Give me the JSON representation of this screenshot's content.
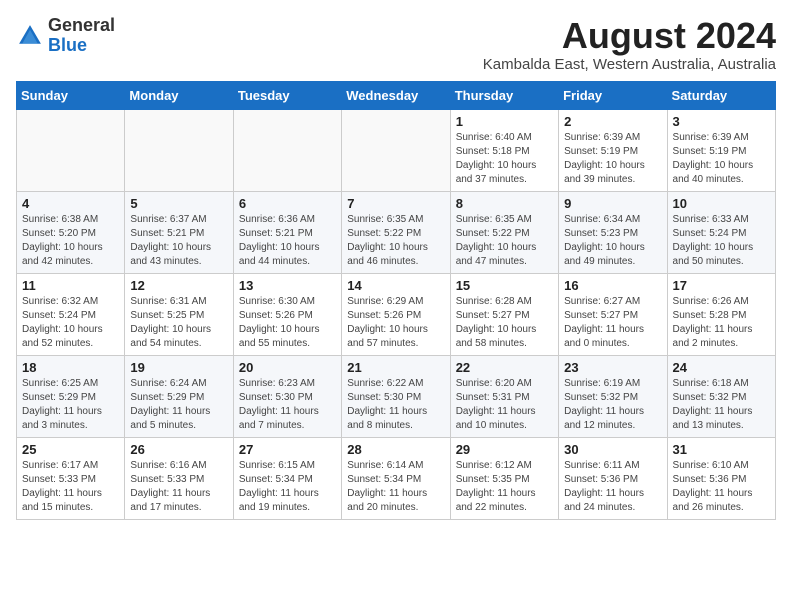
{
  "logo": {
    "general": "General",
    "blue": "Blue"
  },
  "header": {
    "month_year": "August 2024",
    "location": "Kambalda East, Western Australia, Australia"
  },
  "days_of_week": [
    "Sunday",
    "Monday",
    "Tuesday",
    "Wednesday",
    "Thursday",
    "Friday",
    "Saturday"
  ],
  "weeks": [
    [
      {
        "day": "",
        "info": ""
      },
      {
        "day": "",
        "info": ""
      },
      {
        "day": "",
        "info": ""
      },
      {
        "day": "",
        "info": ""
      },
      {
        "day": "1",
        "info": "Sunrise: 6:40 AM\nSunset: 5:18 PM\nDaylight: 10 hours\nand 37 minutes."
      },
      {
        "day": "2",
        "info": "Sunrise: 6:39 AM\nSunset: 5:19 PM\nDaylight: 10 hours\nand 39 minutes."
      },
      {
        "day": "3",
        "info": "Sunrise: 6:39 AM\nSunset: 5:19 PM\nDaylight: 10 hours\nand 40 minutes."
      }
    ],
    [
      {
        "day": "4",
        "info": "Sunrise: 6:38 AM\nSunset: 5:20 PM\nDaylight: 10 hours\nand 42 minutes."
      },
      {
        "day": "5",
        "info": "Sunrise: 6:37 AM\nSunset: 5:21 PM\nDaylight: 10 hours\nand 43 minutes."
      },
      {
        "day": "6",
        "info": "Sunrise: 6:36 AM\nSunset: 5:21 PM\nDaylight: 10 hours\nand 44 minutes."
      },
      {
        "day": "7",
        "info": "Sunrise: 6:35 AM\nSunset: 5:22 PM\nDaylight: 10 hours\nand 46 minutes."
      },
      {
        "day": "8",
        "info": "Sunrise: 6:35 AM\nSunset: 5:22 PM\nDaylight: 10 hours\nand 47 minutes."
      },
      {
        "day": "9",
        "info": "Sunrise: 6:34 AM\nSunset: 5:23 PM\nDaylight: 10 hours\nand 49 minutes."
      },
      {
        "day": "10",
        "info": "Sunrise: 6:33 AM\nSunset: 5:24 PM\nDaylight: 10 hours\nand 50 minutes."
      }
    ],
    [
      {
        "day": "11",
        "info": "Sunrise: 6:32 AM\nSunset: 5:24 PM\nDaylight: 10 hours\nand 52 minutes."
      },
      {
        "day": "12",
        "info": "Sunrise: 6:31 AM\nSunset: 5:25 PM\nDaylight: 10 hours\nand 54 minutes."
      },
      {
        "day": "13",
        "info": "Sunrise: 6:30 AM\nSunset: 5:26 PM\nDaylight: 10 hours\nand 55 minutes."
      },
      {
        "day": "14",
        "info": "Sunrise: 6:29 AM\nSunset: 5:26 PM\nDaylight: 10 hours\nand 57 minutes."
      },
      {
        "day": "15",
        "info": "Sunrise: 6:28 AM\nSunset: 5:27 PM\nDaylight: 10 hours\nand 58 minutes."
      },
      {
        "day": "16",
        "info": "Sunrise: 6:27 AM\nSunset: 5:27 PM\nDaylight: 11 hours\nand 0 minutes."
      },
      {
        "day": "17",
        "info": "Sunrise: 6:26 AM\nSunset: 5:28 PM\nDaylight: 11 hours\nand 2 minutes."
      }
    ],
    [
      {
        "day": "18",
        "info": "Sunrise: 6:25 AM\nSunset: 5:29 PM\nDaylight: 11 hours\nand 3 minutes."
      },
      {
        "day": "19",
        "info": "Sunrise: 6:24 AM\nSunset: 5:29 PM\nDaylight: 11 hours\nand 5 minutes."
      },
      {
        "day": "20",
        "info": "Sunrise: 6:23 AM\nSunset: 5:30 PM\nDaylight: 11 hours\nand 7 minutes."
      },
      {
        "day": "21",
        "info": "Sunrise: 6:22 AM\nSunset: 5:30 PM\nDaylight: 11 hours\nand 8 minutes."
      },
      {
        "day": "22",
        "info": "Sunrise: 6:20 AM\nSunset: 5:31 PM\nDaylight: 11 hours\nand 10 minutes."
      },
      {
        "day": "23",
        "info": "Sunrise: 6:19 AM\nSunset: 5:32 PM\nDaylight: 11 hours\nand 12 minutes."
      },
      {
        "day": "24",
        "info": "Sunrise: 6:18 AM\nSunset: 5:32 PM\nDaylight: 11 hours\nand 13 minutes."
      }
    ],
    [
      {
        "day": "25",
        "info": "Sunrise: 6:17 AM\nSunset: 5:33 PM\nDaylight: 11 hours\nand 15 minutes."
      },
      {
        "day": "26",
        "info": "Sunrise: 6:16 AM\nSunset: 5:33 PM\nDaylight: 11 hours\nand 17 minutes."
      },
      {
        "day": "27",
        "info": "Sunrise: 6:15 AM\nSunset: 5:34 PM\nDaylight: 11 hours\nand 19 minutes."
      },
      {
        "day": "28",
        "info": "Sunrise: 6:14 AM\nSunset: 5:34 PM\nDaylight: 11 hours\nand 20 minutes."
      },
      {
        "day": "29",
        "info": "Sunrise: 6:12 AM\nSunset: 5:35 PM\nDaylight: 11 hours\nand 22 minutes."
      },
      {
        "day": "30",
        "info": "Sunrise: 6:11 AM\nSunset: 5:36 PM\nDaylight: 11 hours\nand 24 minutes."
      },
      {
        "day": "31",
        "info": "Sunrise: 6:10 AM\nSunset: 5:36 PM\nDaylight: 11 hours\nand 26 minutes."
      }
    ]
  ]
}
